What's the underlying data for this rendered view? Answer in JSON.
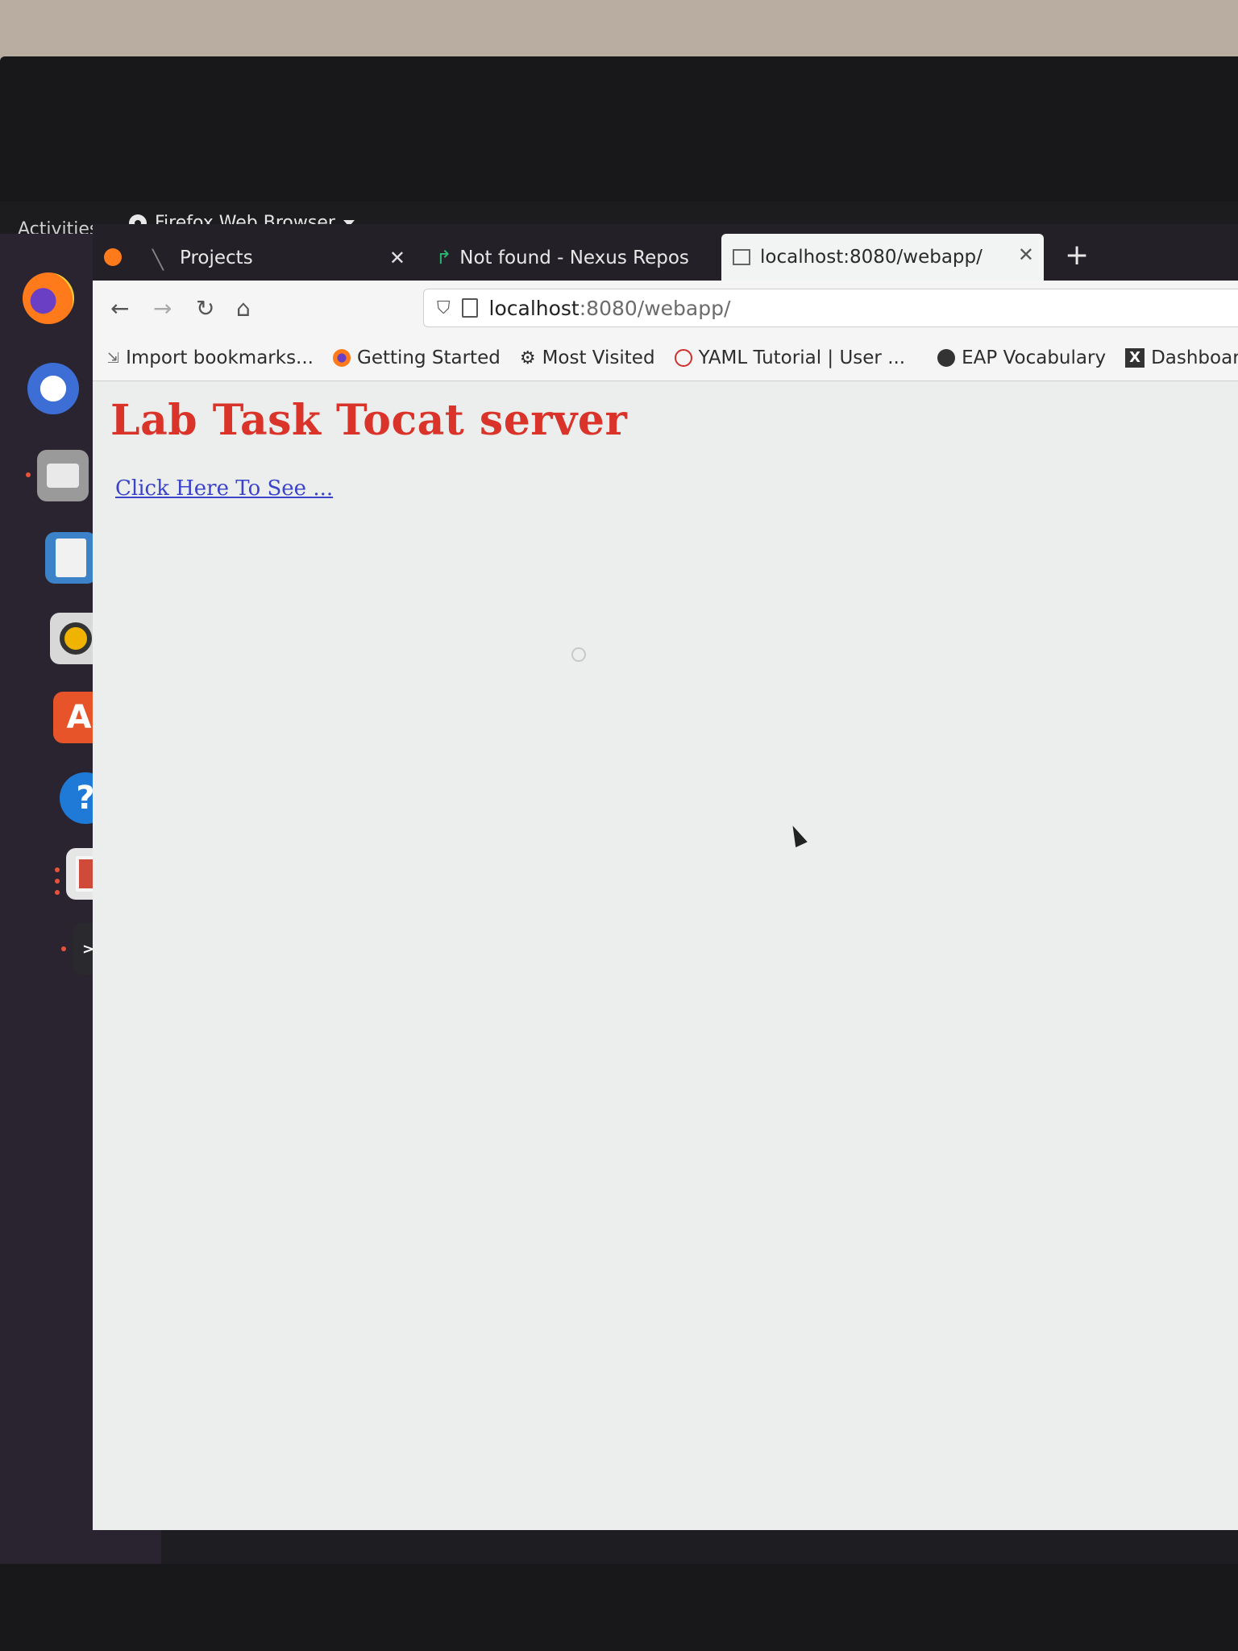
{
  "topbar": {
    "activities": "Activities",
    "app_name": "Firefox Web Browser"
  },
  "dock": {
    "items": [
      {
        "name": "firefox",
        "active": true
      },
      {
        "name": "thunderbird"
      },
      {
        "name": "files",
        "active": true
      },
      {
        "name": "writer"
      },
      {
        "name": "rhythmbox"
      },
      {
        "name": "software"
      },
      {
        "name": "help",
        "glyph": "?"
      },
      {
        "name": "impress",
        "active": true
      },
      {
        "name": "terminal",
        "active": true
      },
      {
        "name": "show-apps"
      }
    ]
  },
  "tabs": [
    {
      "label": "Projects",
      "active": false
    },
    {
      "label": "Not found - Nexus Repos",
      "active": false
    },
    {
      "label": "localhost:8080/webapp/",
      "active": true
    }
  ],
  "navbar": {
    "url_host": "localhost",
    "url_rest": ":8080/webapp/"
  },
  "bookmarks": [
    {
      "label": "Import bookmarks...",
      "icon": "import-icon"
    },
    {
      "label": "Getting Started",
      "icon": "firefox-icon"
    },
    {
      "label": "Most Visited",
      "icon": "gear-icon"
    },
    {
      "label": "YAML Tutorial | User ...",
      "icon": "yaml-icon"
    },
    {
      "label": "EAP Vocabulary",
      "icon": "eap-icon"
    },
    {
      "label": "Dashboard",
      "icon": "x-icon"
    }
  ],
  "page": {
    "heading": "Lab Task Tocat server",
    "link": "Click Here To See ..."
  },
  "colors": {
    "heading": "#d9332a",
    "link": "#3a43c9",
    "tabbar": "#232127",
    "dock": "#2a2430"
  }
}
